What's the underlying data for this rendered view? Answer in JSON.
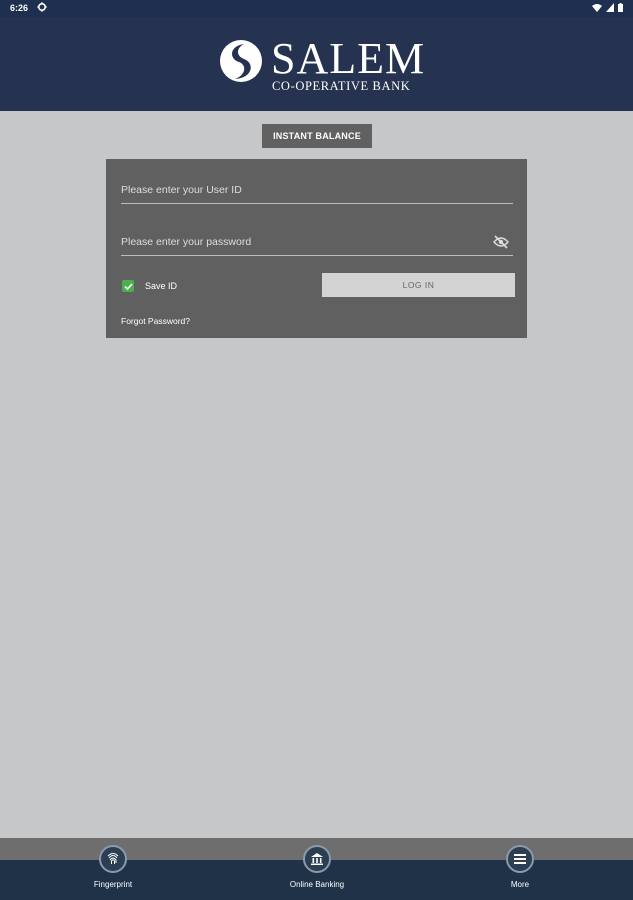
{
  "status_bar": {
    "time": "6:26"
  },
  "brand": {
    "name": "SALEM",
    "subtitle": "CO-OPERATIVE BANK"
  },
  "instant_balance_label": "INSTANT BALANCE",
  "login": {
    "user_id_placeholder": "Please enter your User ID",
    "user_id_value": "",
    "password_placeholder": "Please enter your password",
    "password_value": "",
    "save_id_label": "Save ID",
    "save_id_checked": true,
    "login_label": "LOG IN",
    "forgot_label": "Forgot Password?"
  },
  "bottom_nav": [
    {
      "label": "Fingerprint",
      "icon": "fingerprint-icon"
    },
    {
      "label": "Online Banking",
      "icon": "bank-icon"
    },
    {
      "label": "More",
      "icon": "menu-icon"
    }
  ],
  "colors": {
    "header": "#253350",
    "background": "#c6c7c9",
    "card": "#606060",
    "checkbox": "#4caf50",
    "bottom_nav": "#1f3247"
  }
}
